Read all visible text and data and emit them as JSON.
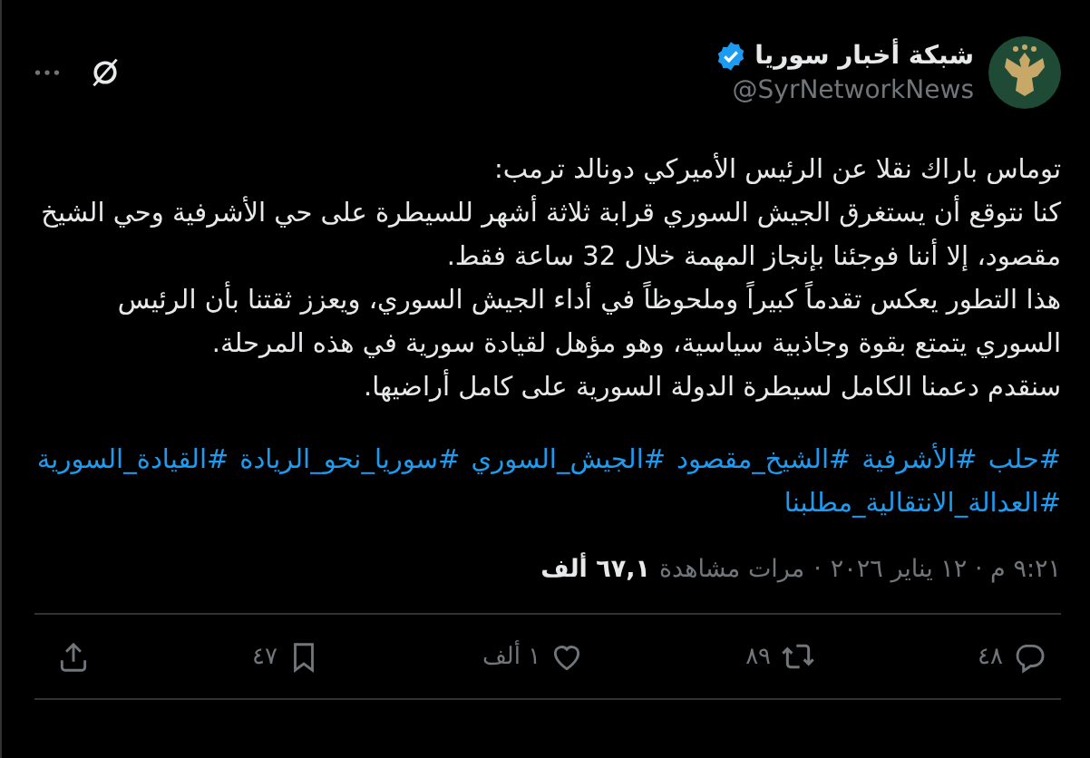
{
  "author": {
    "name": "شبكة أخبار سوريا",
    "handle": "@SyrNetworkNews",
    "verified": true
  },
  "body": [
    "توماس باراك نقلا عن الرئيس الأميركي دونالد ترمب:",
    "كنا نتوقع أن يستغرق الجيش السوري قرابة ثلاثة أشهر للسيطرة على حي الأشرفية وحي الشيخ مقصود، إلا أننا فوجئنا بإنجاز المهمة خلال 32 ساعة فقط.",
    "هذا التطور يعكس تقدماً كبيراً وملحوظاً في أداء الجيش السوري، ويعزز ثقتنا بأن الرئيس السوري يتمتع بقوة وجاذبية سياسية، وهو مؤهل لقيادة سورية في هذه المرحلة.",
    "سنقدم دعمنا الكامل لسيطرة الدولة السورية على كامل أراضيها."
  ],
  "hashtags": [
    "#حلب",
    "#الأشرفية",
    "#الشيخ_مقصود",
    "#الجيش_السوري",
    "#سوريا_نحو_الريادة",
    "#القيادة_السورية",
    "#العدالة_الانتقالية_مطلبنا"
  ],
  "meta": {
    "timestamp": "٩:٢١ م · ١٢ يناير ٢٠٢٦",
    "separator": "·",
    "views_count": "٦٧,١ ألف",
    "views_label": "مرات مشاهدة"
  },
  "actions": [
    {
      "kind": "reply",
      "count": "٤٨"
    },
    {
      "kind": "repost",
      "count": "٨٩"
    },
    {
      "kind": "like",
      "count": "١ ألف"
    },
    {
      "kind": "bookmark",
      "count": "٤٧"
    },
    {
      "kind": "share"
    }
  ]
}
